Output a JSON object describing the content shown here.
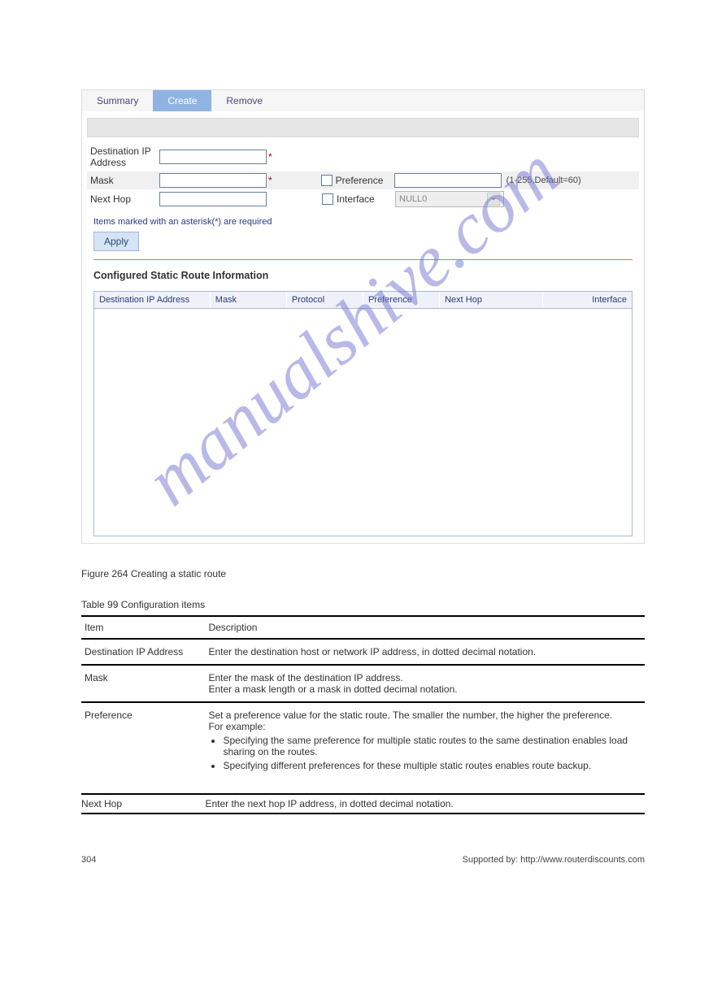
{
  "tabs": {
    "summary": "Summary",
    "create": "Create",
    "remove": "Remove"
  },
  "form": {
    "dest_label": "Destination IP Address",
    "mask_label": "Mask",
    "nexthop_label": "Next Hop",
    "pref_label": "Preference",
    "iface_label": "Interface",
    "iface_value": "NULL0",
    "pref_hint": "(1-255,Default=60)",
    "note": "Items marked with an asterisk(*) are required",
    "apply": "Apply"
  },
  "section": {
    "title": "Configured Static Route Information",
    "cols": {
      "dest": "Destination IP Address",
      "mask": "Mask",
      "proto": "Protocol",
      "pref": "Preference",
      "hop": "Next Hop",
      "iface": "Interface"
    }
  },
  "figure_cap": "Figure 264 Creating a static route",
  "table_cap": "Table 99 Configuration items",
  "spec": {
    "hdr_item": "Item",
    "hdr_desc": "Description",
    "rows": [
      {
        "item": "Destination IP Address",
        "desc": "Enter the destination host or network IP address, in dotted decimal notation."
      },
      {
        "item": "Mask",
        "desc": "Enter the mask of the destination IP address.\nEnter a mask length or a mask in dotted decimal notation."
      },
      {
        "item": "Preference",
        "desc_intro": "Set a preference value for the static route. The smaller the number, the higher the preference.",
        "desc_sub": "For example:",
        "bullets": [
          "Specifying the same preference for multiple static routes to the same destination enables load sharing on the routes.",
          "Specifying different preferences for these multiple static routes enables route backup."
        ]
      },
      {
        "item": "Next Hop",
        "desc": "Enter the next hop IP address, in dotted decimal notation."
      }
    ]
  },
  "footer": {
    "left": "304",
    "right": "Supported by: http://www.routerdiscounts.com"
  },
  "watermark": "manualshive.com"
}
